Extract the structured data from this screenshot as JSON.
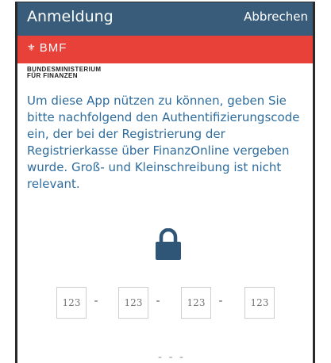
{
  "header": {
    "title": "Anmeldung",
    "cancel_label": "Abbrechen"
  },
  "brand": {
    "logo_text": "BMF",
    "ministry_line1": "BUNDESMINISTERIUM",
    "ministry_line2": "FÜR FINANZEN"
  },
  "instructions": "Um diese App nützen zu können, geben Sie bitte nachfolgend den Authentifizierungscode ein, der bei der Registrierung der Registrierkasse über FinanzOnline vergeben wurde. Groß- und Kleinschreibung ist nicht relevant.",
  "code_fields": [
    {
      "placeholder": "123"
    },
    {
      "placeholder": "123"
    },
    {
      "placeholder": "123"
    },
    {
      "placeholder": "123"
    }
  ],
  "code_separator": "-",
  "more_indicator": "- - -",
  "colors": {
    "header": "#385c7a",
    "brand": "#e8413a",
    "text": "#2e6c9e",
    "lock": "#2f5677"
  }
}
